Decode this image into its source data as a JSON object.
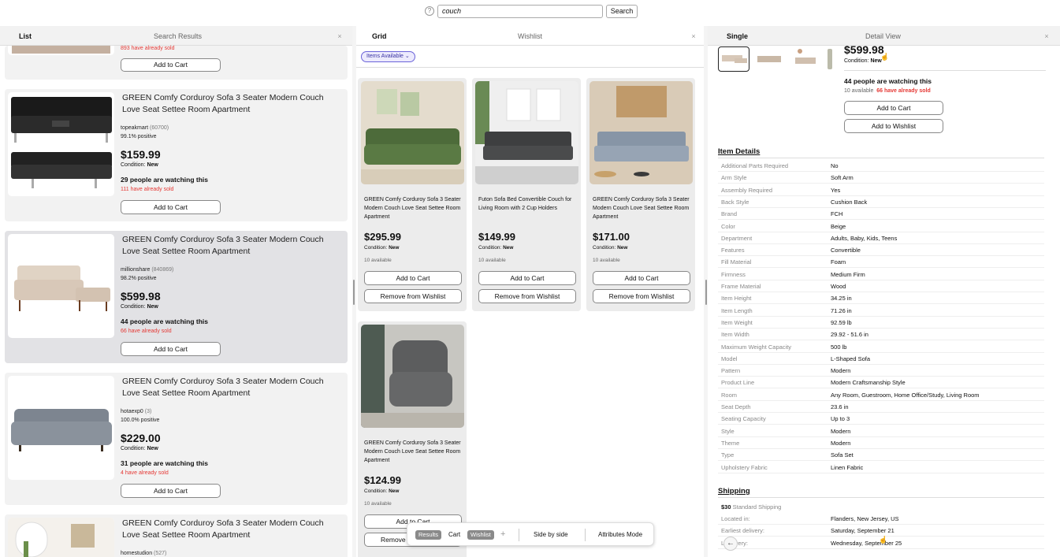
{
  "search": {
    "value": "couch",
    "button": "Search",
    "help": "?"
  },
  "list_panel": {
    "title": "List",
    "center": "Search Results",
    "close": "×",
    "top_card": {
      "sold": "893 have already sold",
      "cart": "Add to Cart"
    },
    "cards": [
      {
        "title": "GREEN Comfy Corduroy Sofa 3 Seater Modern Couch Love Seat Settee Room Apartment",
        "seller": "topeakmart",
        "count": "(60700)",
        "positive": "99.1% positive",
        "price": "$159.99",
        "condition_label": "Condition:",
        "condition": "New",
        "watching": "29 people are watching this",
        "sold": "111 have already sold",
        "cart": "Add to Cart"
      },
      {
        "title": "GREEN Comfy Corduroy Sofa 3 Seater Modern Couch Love Seat Settee Room Apartment",
        "seller": "millionshare",
        "count": "(840869)",
        "positive": "98.2% positive",
        "price": "$599.98",
        "condition_label": "Condition:",
        "condition": "New",
        "watching": "44 people are watching this",
        "sold": "66 have already sold",
        "cart": "Add to Cart"
      },
      {
        "title": "GREEN Comfy Corduroy Sofa 3 Seater Modern Couch Love Seat Settee Room Apartment",
        "seller": "hotaexp0",
        "count": "(3)",
        "positive": "100.0% positive",
        "price": "$229.00",
        "condition_label": "Condition:",
        "condition": "New",
        "watching": "31 people are watching this",
        "sold": "4 have already sold",
        "cart": "Add to Cart"
      },
      {
        "title": "GREEN Comfy Corduroy Sofa 3 Seater Modern Couch Love Seat Settee Room Apartment",
        "seller": "homestudion",
        "count": "(527)"
      }
    ]
  },
  "grid_panel": {
    "title": "Grid",
    "center": "Wishlist",
    "close": "×",
    "filter": "Items Available ⌄",
    "cards": [
      {
        "title": "GREEN Comfy Corduroy Sofa 3 Seater Modern Couch Love Seat Settee Room Apartment",
        "price": "$295.99",
        "condition_label": "Condition:",
        "condition": "New",
        "avail": "10 available",
        "cart": "Add to Cart",
        "remove": "Remove from Wishlist"
      },
      {
        "title": "Futon Sofa Bed Convertible Couch for Living Room with 2 Cup Holders",
        "price": "$149.99",
        "condition_label": "Condition:",
        "condition": "New",
        "avail": "10 available",
        "cart": "Add to Cart",
        "remove": "Remove from Wishlist"
      },
      {
        "title": "GREEN Comfy Corduroy Sofa 3 Seater Modern Couch Love Seat Settee Room Apartment",
        "price": "$171.00",
        "condition_label": "Condition:",
        "condition": "New",
        "avail": "10 available",
        "cart": "Add to Cart",
        "remove": "Remove from Wishlist"
      },
      {
        "title": "GREEN Comfy Corduroy Sofa 3 Seater Modern Couch Love Seat Settee Room Apartment",
        "price": "$124.99",
        "condition_label": "Condition:",
        "condition": "New",
        "avail": "10 available",
        "cart": "Add to Cart",
        "remove": "Remove f"
      }
    ]
  },
  "detail_panel": {
    "title": "Single",
    "center": "Detail View",
    "close": "×",
    "price": "$599.98",
    "condition_label": "Condition:",
    "condition": "New",
    "watching": "44 people are watching this",
    "available": "10 available",
    "sold": "66 have already sold",
    "cart": "Add to Cart",
    "wishlist": "Add to Wishlist",
    "details_heading": "Item Details",
    "details": [
      [
        "Additional Parts Required",
        "No"
      ],
      [
        "Arm Style",
        "Soft Arm"
      ],
      [
        "Assembly Required",
        "Yes"
      ],
      [
        "Back Style",
        "Cushion Back"
      ],
      [
        "Brand",
        "FCH"
      ],
      [
        "Color",
        "Beige"
      ],
      [
        "Department",
        "Adults, Baby, Kids, Teens"
      ],
      [
        "Features",
        "Convertible"
      ],
      [
        "Fill Material",
        "Foam"
      ],
      [
        "Firmness",
        "Medium Firm"
      ],
      [
        "Frame Material",
        "Wood"
      ],
      [
        "Item Height",
        "34.25 in"
      ],
      [
        "Item Length",
        "71.26 in"
      ],
      [
        "Item Weight",
        "92.59 lb"
      ],
      [
        "Item Width",
        "29.92 - 51.6 in"
      ],
      [
        "Maximum Weight Capacity",
        "500 lb"
      ],
      [
        "Model",
        "L-Shaped Sofa"
      ],
      [
        "Pattern",
        "Modern"
      ],
      [
        "Product Line",
        "Modern Craftsmanship Style"
      ],
      [
        "Room",
        "Any Room, Guestroom, Home Office/Study, Living Room"
      ],
      [
        "Seat Depth",
        "23.6 in"
      ],
      [
        "Seating Capacity",
        "Up to 3"
      ],
      [
        "Style",
        "Modern"
      ],
      [
        "Theme",
        "Modern"
      ],
      [
        "Type",
        "Sofa Set"
      ],
      [
        "Upholstery Fabric",
        "Linen Fabric"
      ]
    ],
    "shipping_heading": "Shipping",
    "shipping_cost": "$30",
    "shipping_method": "Standard Shipping",
    "shipping": [
      [
        "Located in:",
        "Flanders, New Jersey, US"
      ],
      [
        "Earliest delivery:",
        "Saturday, September 21"
      ],
      [
        "L  delivery:",
        "Wednesday, September 25"
      ]
    ]
  },
  "bottom_bar": {
    "results": "Results",
    "cart": "Cart",
    "wishlist": "Wishlist",
    "plus": "+",
    "side": "Side by side",
    "attributes": "Attributes Mode"
  }
}
